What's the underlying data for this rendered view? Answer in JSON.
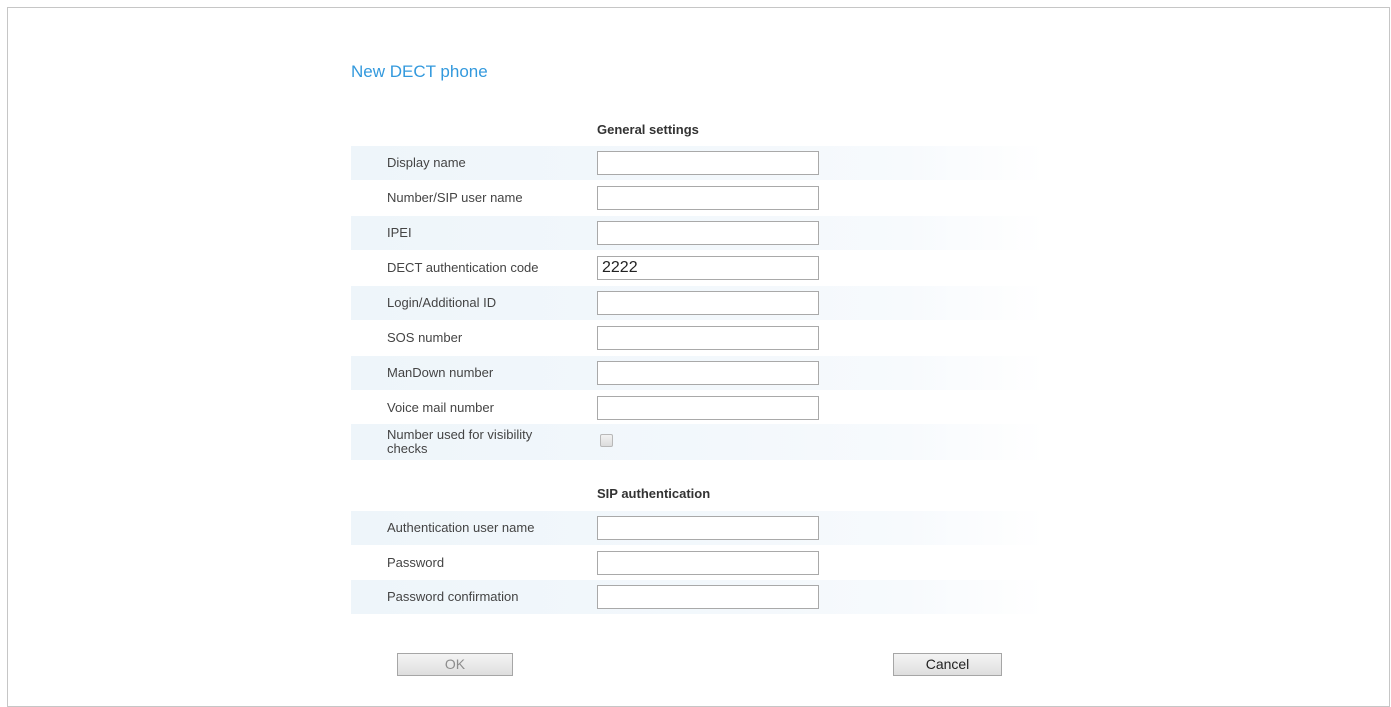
{
  "page": {
    "title": "New DECT phone"
  },
  "general": {
    "heading": "General settings",
    "fields": [
      {
        "label": "Display name",
        "value": ""
      },
      {
        "label": "Number/SIP user name",
        "value": ""
      },
      {
        "label": "IPEI",
        "value": ""
      },
      {
        "label": "DECT authentication code",
        "value": "2222"
      },
      {
        "label": "Login/Additional ID",
        "value": ""
      },
      {
        "label": "SOS number",
        "value": ""
      },
      {
        "label": "ManDown number",
        "value": ""
      },
      {
        "label": "Voice mail number",
        "value": ""
      }
    ],
    "visibility_check": {
      "label": "Number used for visibility checks",
      "checked": false,
      "disabled": true
    }
  },
  "sip": {
    "heading": "SIP authentication",
    "fields": [
      {
        "label": "Authentication user name",
        "value": ""
      },
      {
        "label": "Password",
        "value": ""
      },
      {
        "label": "Password confirmation",
        "value": ""
      }
    ]
  },
  "actions": {
    "ok_label": "OK",
    "cancel_label": "Cancel",
    "ok_disabled": true
  },
  "colors": {
    "title": "#3399dd",
    "row_shade": "#eef5fa"
  }
}
